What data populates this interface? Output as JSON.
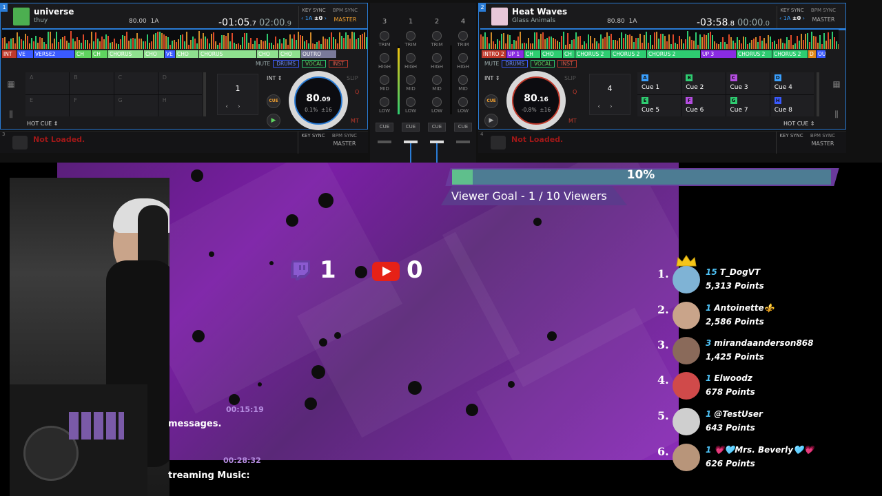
{
  "deck1": {
    "number": "1",
    "title": "universe",
    "artist": "thuy",
    "bpm": "80.00",
    "key": "1A",
    "time_elapsed": "-01:05",
    "time_elapsed_frac": ".7",
    "time_remaining": "02:00",
    "time_remaining_frac": ".9",
    "key_sync_label": "KEY SYNC",
    "key_value": "1A",
    "key_offset": "±0",
    "bpm_sync_label": "BPM SYNC",
    "master_label": "MASTER",
    "segments": [
      "INT",
      "VE",
      "VERSE2",
      "CH",
      "CH",
      "CHORUS",
      "CHO",
      "VE",
      "CHO",
      "CHORUS",
      "CHO",
      "CHO",
      "OUTRO"
    ],
    "mute_label": "MUTE",
    "stems": [
      "DRUMS",
      "VOCAL",
      "INST"
    ],
    "pad_letters": [
      "A",
      "B",
      "C",
      "D",
      "E",
      "F",
      "G",
      "H"
    ],
    "mode_label": "HOT CUE",
    "loop_value": "1",
    "int_label": "INT",
    "slip_label": "SLIP",
    "q_label": "Q",
    "mt_label": "MT",
    "cue_label": "CUE",
    "jog_bpm": "80",
    "jog_bpm_frac": ".09",
    "jog_pitch": "0.1%",
    "jog_range": "±16"
  },
  "deck2": {
    "number": "2",
    "title": "Heat Waves",
    "artist": "Glass Animals",
    "bpm": "80.80",
    "key": "1A",
    "time_elapsed": "-03:58",
    "time_elapsed_frac": ".8",
    "time_remaining": "00:00",
    "time_remaining_frac": ".0",
    "key_sync_label": "KEY SYNC",
    "key_value": "1A",
    "key_offset": "±0",
    "bpm_sync_label": "BPM SYNC",
    "master_label": "MASTER",
    "segments": [
      "INTRO 2",
      "UP 1",
      "CH",
      "CHO",
      "CH",
      "CHORUS 2",
      "CHORUS 2",
      "CHORUS 2",
      "UP 3",
      "CHORUS 2",
      "CHORUS 2",
      "D",
      "OU"
    ],
    "mute_label": "MUTE",
    "stems": [
      "DRUMS",
      "VOCAL",
      "INST"
    ],
    "cues": [
      {
        "letter": "A",
        "label": "Cue 1",
        "color": "#3aa0ff"
      },
      {
        "letter": "B",
        "label": "Cue 2",
        "color": "#2ecc71"
      },
      {
        "letter": "C",
        "label": "Cue 3",
        "color": "#b44de0"
      },
      {
        "letter": "D",
        "label": "Cue 4",
        "color": "#3aa0ff"
      },
      {
        "letter": "E",
        "label": "Cue 5",
        "color": "#2ecc71"
      },
      {
        "letter": "F",
        "label": "Cue 6",
        "color": "#b44de0"
      },
      {
        "letter": "G",
        "label": "Cue 7",
        "color": "#2ecc71"
      },
      {
        "letter": "H",
        "label": "Cue 8",
        "color": "#3a5aff"
      }
    ],
    "mode_label": "HOT CUE",
    "loop_value": "4",
    "int_label": "INT",
    "slip_label": "SLIP",
    "q_label": "Q",
    "mt_label": "MT",
    "cue_label": "CUE",
    "jog_bpm": "80",
    "jog_bpm_frac": ".16",
    "jog_pitch": "-0.8%",
    "jog_range": "±16"
  },
  "deck3": {
    "number": "3",
    "status": "Not Loaded.",
    "key_sync_label": "KEY SYNC",
    "bpm_sync_label": "BPM SYNC",
    "master_label": "MASTER"
  },
  "deck4": {
    "number": "4",
    "status": "Not Loaded.",
    "key_sync_label": "KEY SYNC",
    "bpm_sync_label": "BPM SYNC",
    "master_label": "MASTER"
  },
  "mixer": {
    "channels": [
      "3",
      "1",
      "2",
      "4"
    ],
    "knob_labels": [
      "TRIM",
      "HIGH",
      "MID",
      "LOW"
    ],
    "cue_label": "CUE"
  },
  "overlay": {
    "goal_percent": "10%",
    "goal_fraction": 0.1,
    "goal_label": "Viewer Goal - 1 / 10 Viewers",
    "twitch_count": "1",
    "youtube_count": "0",
    "chat": [
      {
        "time": "00:15:19",
        "text": "messages."
      },
      {
        "time": "00:28:32",
        "text": "treaming Music:"
      }
    ],
    "leaderboard": [
      {
        "rank": "1.",
        "level": "15",
        "name": "T_DogVT",
        "points": "5,313 Points",
        "avatar_color": "#7fb3d5"
      },
      {
        "rank": "2.",
        "level": "1",
        "name": "Antoinette⚜️",
        "points": "2,586 Points",
        "avatar_color": "#c9a48a"
      },
      {
        "rank": "3.",
        "level": "3",
        "name": "mirandaanderson868",
        "points": "1,425 Points",
        "avatar_color": "#8a6a5a"
      },
      {
        "rank": "4.",
        "level": "1",
        "name": "Elwoodz",
        "points": "678 Points",
        "avatar_color": "#d04a4a"
      },
      {
        "rank": "5.",
        "level": "1",
        "name": "@TestUser",
        "points": "643 Points",
        "avatar_color": "#cfcfcf"
      },
      {
        "rank": "6.",
        "level": "1",
        "name": "💗🩵Mrs. Beverly🩵💗",
        "points": "626 Points",
        "avatar_color": "#b8957a"
      }
    ]
  },
  "colors": {
    "accent": "#2a7cd6",
    "overlay_purple": "#7b1ea6",
    "goal_fill": "#5fbf8c",
    "youtube_red": "#e62117",
    "twitch_purple": "#6441a5"
  }
}
